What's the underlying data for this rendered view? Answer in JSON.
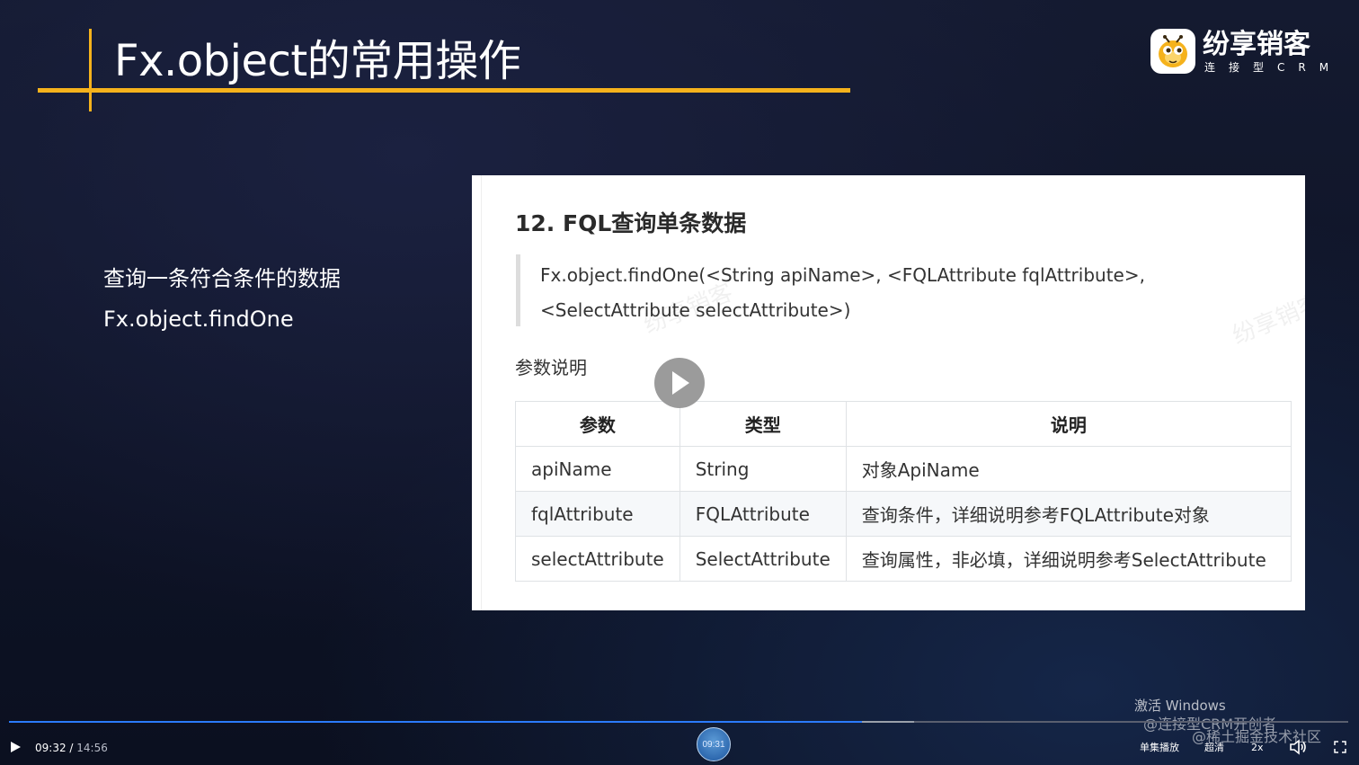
{
  "slide": {
    "title": "Fx.object的常用操作",
    "left_lines": [
      "查询一条符合条件的数据",
      "Fx.object.findOne"
    ]
  },
  "brand": {
    "name": "纷享销客",
    "subtitle": "连接型CRM",
    "accent_color": "#f5b21c"
  },
  "doc": {
    "heading": "12. FQL查询单条数据",
    "signature": "Fx.object.findOne(<String apiName>, <FQLAttribute fqlAttribute>, <SelectAttribute selectAttribute>)",
    "param_label": "参数说明",
    "watermark": "纷享销客",
    "table": {
      "headers": [
        "参数",
        "类型",
        "说明"
      ],
      "rows": [
        [
          "apiName",
          "String",
          "对象ApiName"
        ],
        [
          "fqlAttribute",
          "FQLAttribute",
          "查询条件，详细说明参考FQLAttribute对象"
        ],
        [
          "selectAttribute",
          "SelectAttribute",
          "查询属性，非必填，详细说明参考SelectAttribute"
        ]
      ]
    }
  },
  "player": {
    "current_time": "09:32",
    "duration": "14:56",
    "thumb_time": "09:31",
    "progress_fraction": 0.637,
    "buffered_fraction": 0.676,
    "playlist_mode": "单集播放",
    "quality": "超清",
    "speed": "2x",
    "played_color": "#2b7bff"
  },
  "overlays": {
    "activate_windows": "激活 Windows",
    "credit_1": "@连接型CRM开创者",
    "credit_2": "@稀土掘金技术社区"
  }
}
